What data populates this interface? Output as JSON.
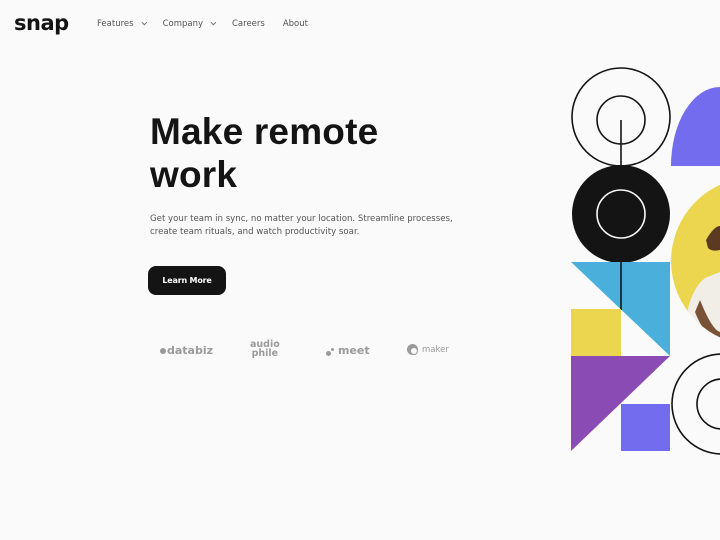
{
  "brand": {
    "logo": "snap"
  },
  "nav": {
    "items": [
      {
        "label": "Features",
        "has_dropdown": true,
        "icon": "chevron-down-icon"
      },
      {
        "label": "Company",
        "has_dropdown": true,
        "icon": "chevron-down-icon"
      },
      {
        "label": "Careers",
        "has_dropdown": false
      },
      {
        "label": "About",
        "has_dropdown": false
      }
    ]
  },
  "hero": {
    "title_line1": "Make remote",
    "title_line2": "work",
    "description": "Get your team in sync, no matter your location. Streamline processes, create team rituals, and watch productivity soar.",
    "cta_label": "Learn More"
  },
  "clients": {
    "databiz": "databiz",
    "audiophile_top": "audio",
    "audiophile_bottom": "phile",
    "meet": "meet",
    "maker": "maker"
  },
  "colors": {
    "background": "#fafafa",
    "text": "#141414",
    "muted": "#555555",
    "logo_gray": "#9a9a9a",
    "violet": "#736cee",
    "yellow": "#ecd650",
    "sky": "#4bafdc",
    "purple": "#8b4bb5",
    "black": "#141414"
  },
  "illustration": {
    "alt": "Smiling person with arms crossed inside a yellow circle surrounded by geometric shapes"
  }
}
